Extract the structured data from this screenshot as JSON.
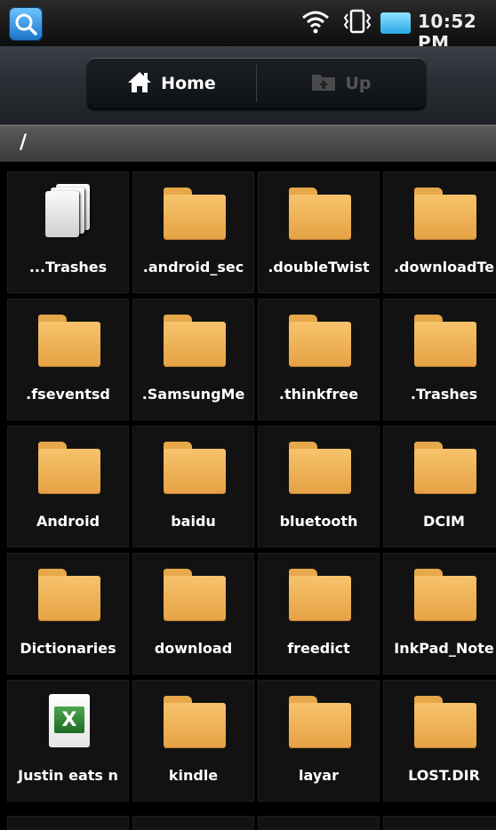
{
  "status_bar": {
    "time": "10:52 PM",
    "icons": [
      "wifi-icon",
      "vibrate-icon",
      "signal-icon",
      "battery-icon"
    ],
    "app_icon": "search-app-icon"
  },
  "toolbar": {
    "home_label": "Home",
    "up_label": "Up"
  },
  "path": "/",
  "files": [
    {
      "name": "...Trashes",
      "type": "document-stack"
    },
    {
      "name": ".android_sec",
      "type": "folder"
    },
    {
      "name": ".doubleTwist",
      "type": "folder"
    },
    {
      "name": ".downloadTe",
      "type": "folder"
    },
    {
      "name": ".fseventsd",
      "type": "folder"
    },
    {
      "name": ".SamsungMe",
      "type": "folder"
    },
    {
      "name": ".thinkfree",
      "type": "folder"
    },
    {
      "name": ".Trashes",
      "type": "folder"
    },
    {
      "name": "Android",
      "type": "folder"
    },
    {
      "name": "baidu",
      "type": "folder"
    },
    {
      "name": "bluetooth",
      "type": "folder"
    },
    {
      "name": "DCIM",
      "type": "folder"
    },
    {
      "name": "Dictionaries",
      "type": "folder"
    },
    {
      "name": "download",
      "type": "folder"
    },
    {
      "name": "freedict",
      "type": "folder"
    },
    {
      "name": "InkPad_Note",
      "type": "folder"
    },
    {
      "name": "Justin eats n",
      "type": "excel"
    },
    {
      "name": "kindle",
      "type": "folder"
    },
    {
      "name": "layar",
      "type": "folder"
    },
    {
      "name": "LOST.DIR",
      "type": "folder"
    }
  ],
  "colors": {
    "folder": "#f2b85a",
    "toolbar": "#2d3238",
    "background": "#000000"
  }
}
